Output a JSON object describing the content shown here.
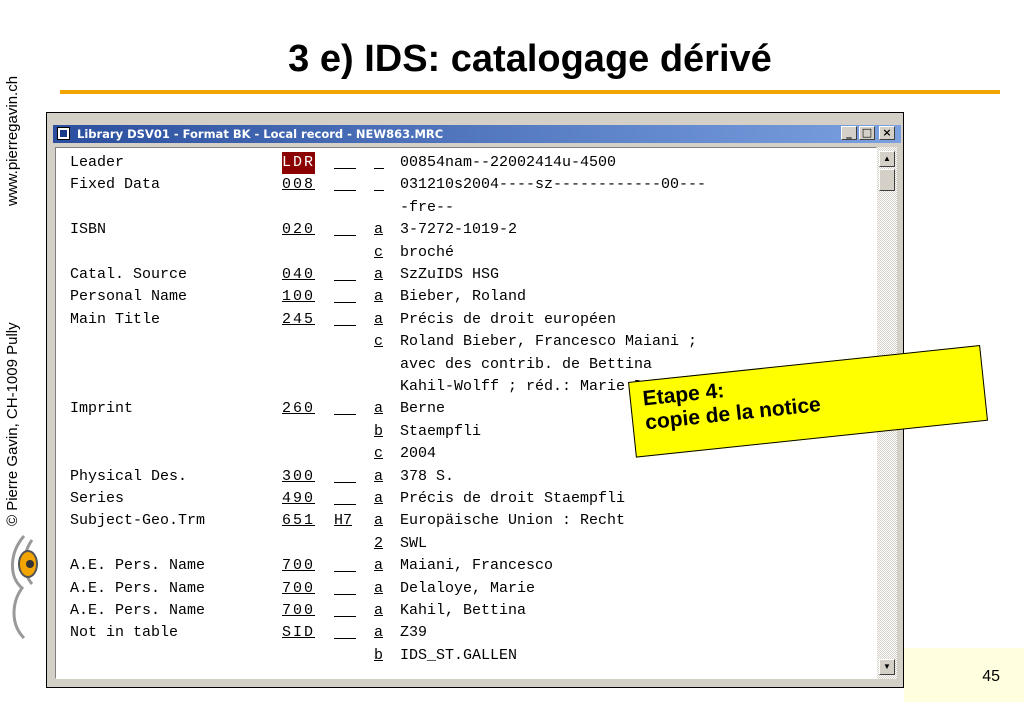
{
  "sidebar": {
    "website": "www.pierregavin.ch",
    "copyright": "© Pierre Gavin, CH-1009 Pully"
  },
  "slide": {
    "title": "3 e) IDS: catalogage dérivé",
    "page_number": "45"
  },
  "window": {
    "title": "Library DSV01 - Format BK - Local record - NEW863.MRC",
    "min_label": "_",
    "max_label": "□",
    "close_label": "×"
  },
  "record": [
    {
      "label": "Leader",
      "tag": "LDR",
      "ind": "",
      "sub": "",
      "value": "00854nam--22002414u-4500",
      "highlight": true
    },
    {
      "label": "Fixed Data",
      "tag": "008",
      "ind": "",
      "sub": "",
      "value": "031210s2004----sz------------00---"
    },
    {
      "label": "",
      "tag": "",
      "ind": "",
      "sub": "",
      "value": "-fre--"
    },
    {
      "label": "ISBN",
      "tag": "020",
      "ind": "",
      "sub": "a",
      "value": "3-7272-1019-2"
    },
    {
      "label": "",
      "tag": "",
      "ind": "",
      "sub": "c",
      "value": "broché"
    },
    {
      "label": "Catal. Source",
      "tag": "040",
      "ind": "",
      "sub": "a",
      "value": "SzZuIDS HSG"
    },
    {
      "label": "Personal Name",
      "tag": "100",
      "ind": "",
      "sub": "a",
      "value": "Bieber, Roland"
    },
    {
      "label": "Main Title",
      "tag": "245",
      "ind": "",
      "sub": "a",
      "value": "Précis de droit européen"
    },
    {
      "label": "",
      "tag": "",
      "ind": "",
      "sub": "c",
      "value": "Roland Bieber, Francesco Maiani ;"
    },
    {
      "label": "",
      "tag": "",
      "ind": "",
      "sub": "",
      "value": "avec des contrib. de Bettina"
    },
    {
      "label": "",
      "tag": "",
      "ind": "",
      "sub": "",
      "value": "Kahil-Wolff ; réd.: Marie Delaloye"
    },
    {
      "label": "Imprint",
      "tag": "260",
      "ind": "",
      "sub": "a",
      "value": "Berne"
    },
    {
      "label": "",
      "tag": "",
      "ind": "",
      "sub": "b",
      "value": "Staempfli"
    },
    {
      "label": "",
      "tag": "",
      "ind": "",
      "sub": "c",
      "value": "2004"
    },
    {
      "label": "Physical Des.",
      "tag": "300",
      "ind": "",
      "sub": "a",
      "value": "378 S."
    },
    {
      "label": "Series",
      "tag": "490",
      "ind": "",
      "sub": "a",
      "value": "Précis de droit Staempfli"
    },
    {
      "label": "Subject-Geo.Trm",
      "tag": "651",
      "ind": "H7",
      "sub": "a",
      "value": "Europäische Union : Recht"
    },
    {
      "label": "",
      "tag": "",
      "ind": "",
      "sub": "2",
      "value": "SWL"
    },
    {
      "label": "A.E. Pers. Name",
      "tag": "700",
      "ind": "",
      "sub": "a",
      "value": "Maiani, Francesco"
    },
    {
      "label": "A.E. Pers. Name",
      "tag": "700",
      "ind": "",
      "sub": "a",
      "value": "Delaloye, Marie"
    },
    {
      "label": "A.E. Pers. Name",
      "tag": "700",
      "ind": "",
      "sub": "a",
      "value": "Kahil, Bettina"
    },
    {
      "label": "Not in table",
      "tag": "SID",
      "ind": "",
      "sub": "a",
      "value": "Z39"
    },
    {
      "label": "",
      "tag": "",
      "ind": "",
      "sub": "b",
      "value": "IDS_ST.GALLEN"
    }
  ],
  "callout": {
    "line1": "Etape 4:",
    "line2": "copie de la notice"
  }
}
